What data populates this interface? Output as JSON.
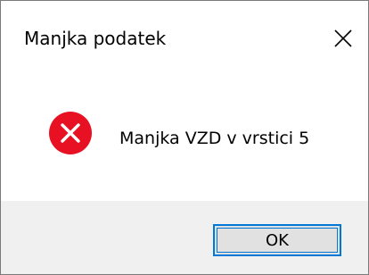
{
  "window": {
    "title": "Manjka podatek"
  },
  "message": {
    "text": "Manjka VZD v vrstici 5",
    "icon": "error-icon"
  },
  "buttons": {
    "ok_label": "OK"
  },
  "colors": {
    "error_red": "#e81123",
    "accent_blue": "#0078d7",
    "button_bar_bg": "#f0f0f0",
    "button_bg": "#e1e1e1"
  }
}
